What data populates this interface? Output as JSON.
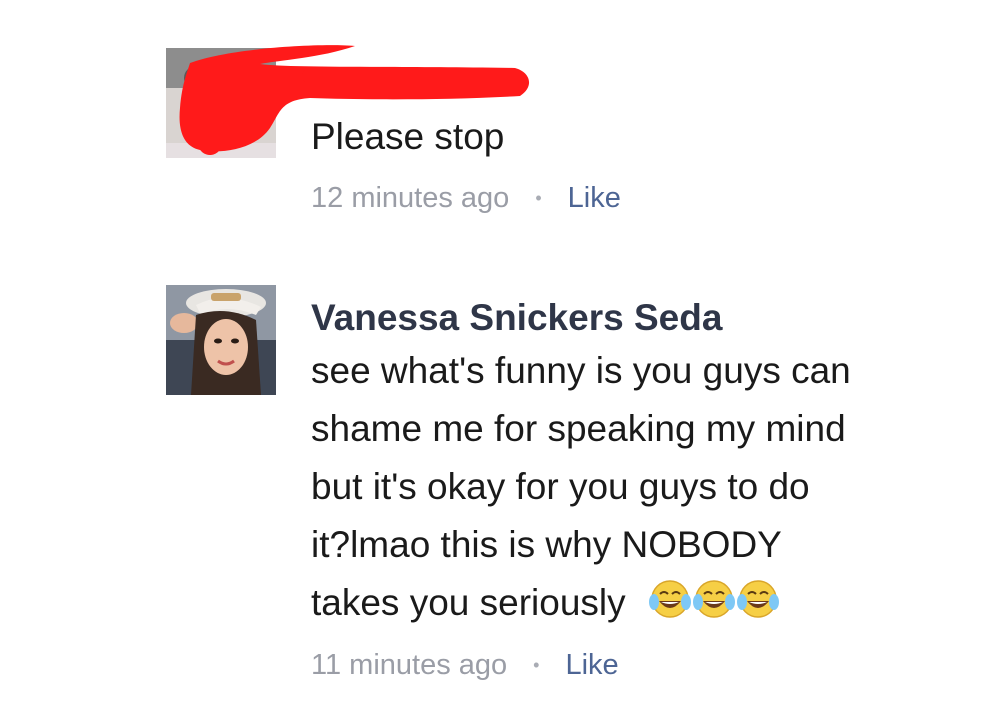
{
  "comments": [
    {
      "author": "",
      "text_lines": [
        "Please stop"
      ],
      "timestamp": "12 minutes ago",
      "like_label": "Like",
      "avatar_redacted": true,
      "redaction_color": "#ff1a1a"
    },
    {
      "author": "Vanessa Snickers Seda",
      "text_lines": [
        "see what's funny is you guys can",
        "shame me for speaking my mind",
        "but it's okay for you guys to do",
        "it?lmao this is why NOBODY",
        "takes you seriously"
      ],
      "emoji": [
        "face-with-tears-of-joy-icon",
        "face-with-tears-of-joy-icon",
        "face-with-tears-of-joy-icon"
      ],
      "timestamp": "11 minutes ago",
      "like_label": "Like"
    }
  ],
  "colors": {
    "author": "#2f3648",
    "text": "#1a1a1a",
    "timestamp": "#9a9da6",
    "link": "#4d6594"
  }
}
